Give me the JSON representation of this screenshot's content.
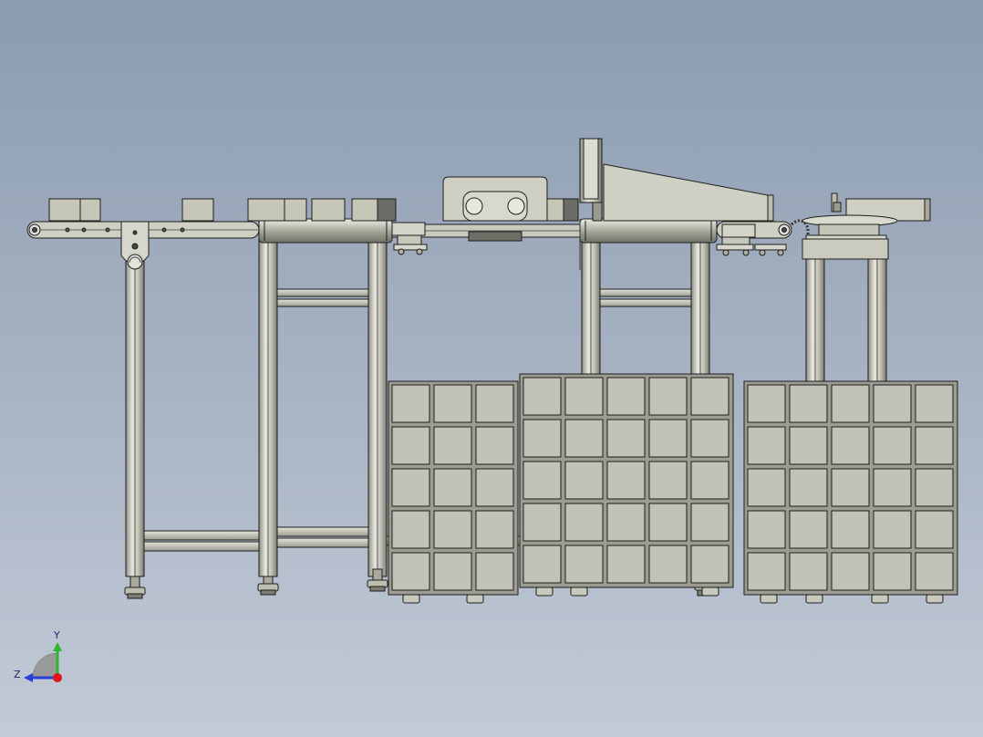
{
  "viewport": {
    "background_top": "#8b9bb0",
    "background_bottom": "#c2cad6"
  },
  "scene": {
    "model_fill": "#c4c4b4",
    "model_edge": "#1e1e1e",
    "frame_fill": "#b8b8ac",
    "crate_cell_fill": "#c2c2b6",
    "box_fill": "#c6c6b6"
  },
  "triad": {
    "y_label": "Y",
    "z_label": "Z",
    "y_color": "#2fb52f",
    "z_color": "#2b3fd8",
    "x_color": "#e0151b"
  }
}
